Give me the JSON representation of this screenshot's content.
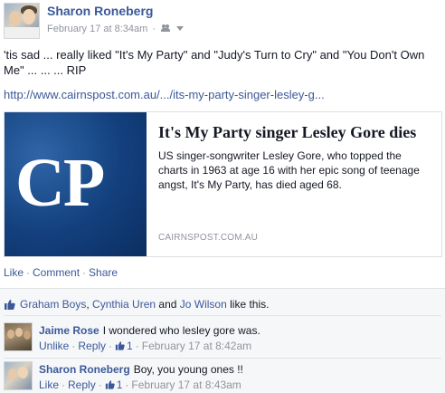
{
  "post": {
    "author": "Sharon Roneberg",
    "timestamp": "February 17 at 8:34am",
    "separator": "·",
    "audience_icon": "friends-icon",
    "text": "'tis sad ... really liked \"It's My Party\" and \"Judy's Turn to Cry\" and \"You Don't Own Me\" ... ... ... RIP",
    "link": "http://www.cairnspost.com.au/.../its-my-party-singer-lesley-g..."
  },
  "share_card": {
    "logo_text": "CP",
    "title": "It's My Party singer Lesley Gore dies",
    "description": "US singer-songwriter Lesley Gore, who topped the charts in 1963 at age 16 with her epic song of teenage angst, It's My Party, has died aged 68.",
    "source": "CAIRNSPOST.COM.AU"
  },
  "actions": {
    "like": "Like",
    "comment": "Comment",
    "share": "Share",
    "dot": "·"
  },
  "likes": {
    "user1": "Graham Boys",
    "sep1": ", ",
    "user2": "Cynthia Uren",
    "and": " and ",
    "user3": "Jo Wilson",
    "suffix": " like this."
  },
  "comments": [
    {
      "name": "Jaime Rose",
      "text": "I wondered who lesley gore was.",
      "action": "Unlike",
      "reply": "Reply",
      "like_count": "1",
      "timestamp": "February 17 at 8:42am"
    },
    {
      "name": "Sharon Roneberg",
      "text": "Boy, you young ones !!",
      "action": "Like",
      "reply": "Reply",
      "like_count": "1",
      "timestamp": "February 17 at 8:43am"
    }
  ],
  "colors": {
    "link_blue": "#3b5998",
    "meta_gray": "#90949c",
    "feedback_bg": "#f6f7f9",
    "logo_blue": "#13407d"
  }
}
